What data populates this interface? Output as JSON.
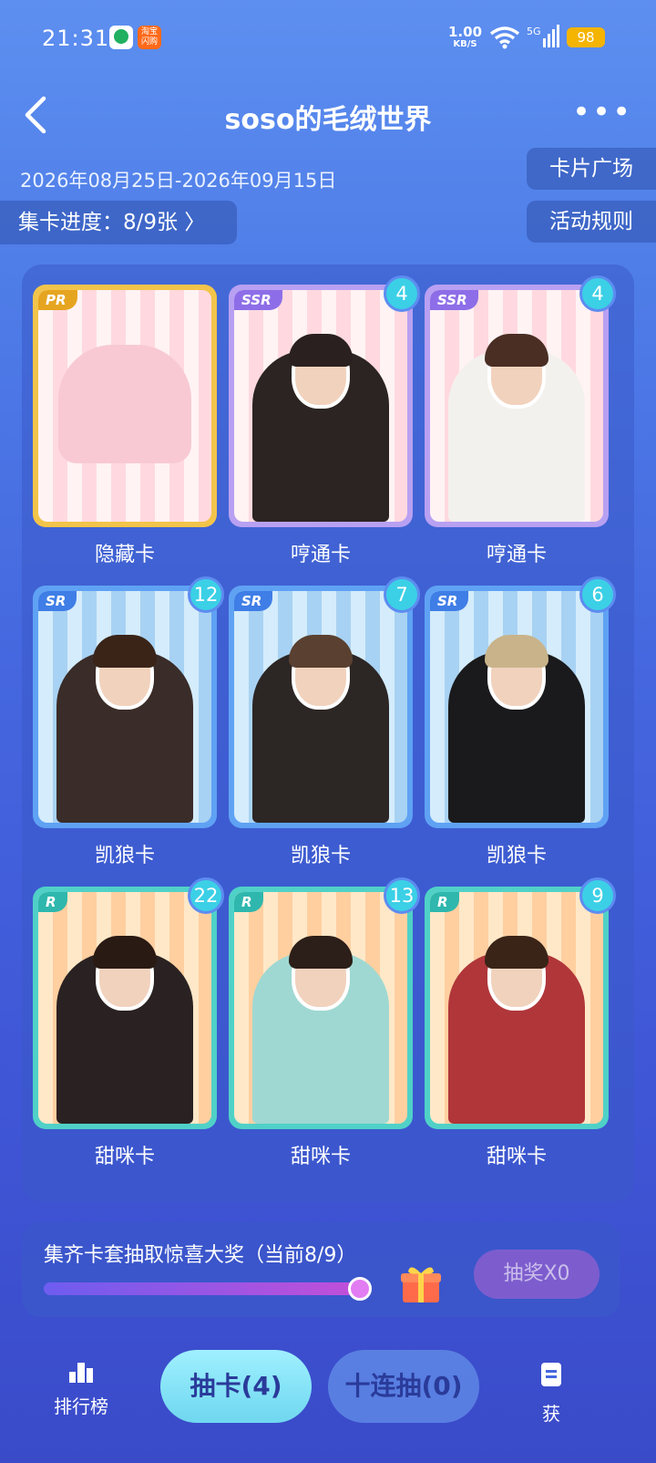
{
  "status": {
    "time": "21:31",
    "speed_value": "1.00",
    "speed_unit": "KB/S",
    "network": "5G",
    "battery": "98"
  },
  "header": {
    "title": "soso的毛绒世界"
  },
  "info": {
    "date_range": "2026年08月25日-2026年09月15日",
    "progress_label": "集卡进度：8/9张 〉"
  },
  "buttons": {
    "square": "卡片广场",
    "rules": "活动规则"
  },
  "cards": [
    {
      "tier": "PR",
      "count": "",
      "caption": "隐藏卡",
      "theme": "#f2c44a"
    },
    {
      "tier": "SSR",
      "count": "4",
      "caption": "哼通卡",
      "theme": "#b8a0f2"
    },
    {
      "tier": "SSR",
      "count": "4",
      "caption": "哼通卡",
      "theme": "#b8a0f2"
    },
    {
      "tier": "SR",
      "count": "12",
      "caption": "凯狼卡",
      "theme": "#5fa2f4"
    },
    {
      "tier": "SR",
      "count": "7",
      "caption": "凯狼卡",
      "theme": "#5fa2f4"
    },
    {
      "tier": "SR",
      "count": "6",
      "caption": "凯狼卡",
      "theme": "#5fa2f4"
    },
    {
      "tier": "R",
      "count": "22",
      "caption": "甜咪卡",
      "theme": "#4fd1c7"
    },
    {
      "tier": "R",
      "count": "13",
      "caption": "甜咪卡",
      "theme": "#4fd1c7"
    },
    {
      "tier": "R",
      "count": "9",
      "caption": "甜咪卡",
      "theme": "#4fd1c7"
    }
  ],
  "prize": {
    "text": "集齐卡套抽取惊喜大奖（当前8/9）",
    "progress": 0.89,
    "draw_label": "抽奖X0"
  },
  "bottom_nav": {
    "ranking": "排行榜",
    "draw_one": "抽卡(4)",
    "draw_ten": "十连抽(0)",
    "get": "获"
  }
}
